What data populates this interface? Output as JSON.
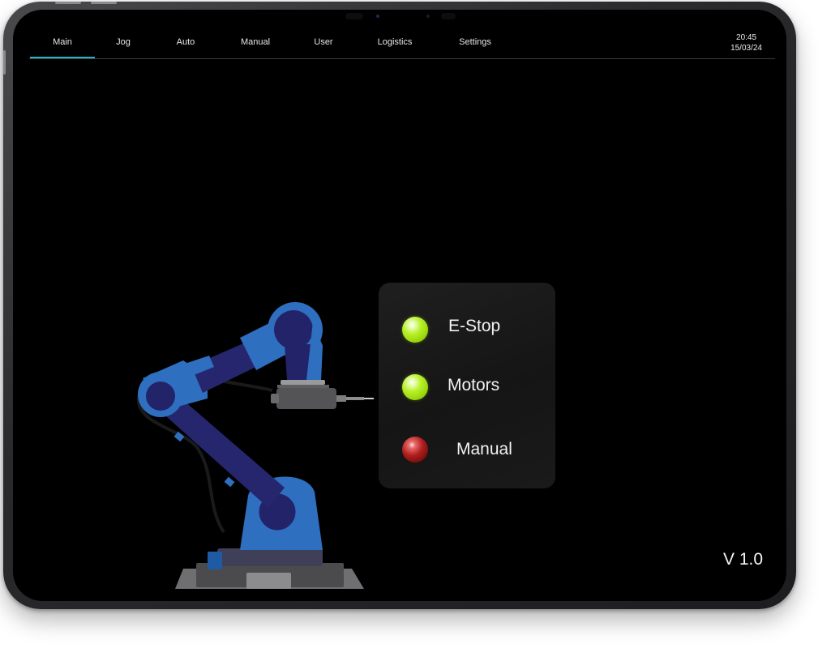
{
  "nav": {
    "tabs": [
      {
        "label": "Main",
        "active": true
      },
      {
        "label": "Jog",
        "active": false
      },
      {
        "label": "Auto",
        "active": false
      },
      {
        "label": "Manual",
        "active": false
      },
      {
        "label": "User",
        "active": false
      },
      {
        "label": "Logistics",
        "active": false
      },
      {
        "label": "Settings",
        "active": false
      }
    ],
    "accent_color": "#2cb3c9"
  },
  "clock": {
    "time": "20:45",
    "date": "15/03/24"
  },
  "status": {
    "items": [
      {
        "label": "E-Stop",
        "state": "green"
      },
      {
        "label": "Motors",
        "state": "green"
      },
      {
        "label": "Manual",
        "state": "red"
      }
    ],
    "colors": {
      "green": "#b8f02a",
      "red": "#b01e1e"
    }
  },
  "version": "V 1.0",
  "illustration": {
    "icon": "robot-arm-icon",
    "colors": {
      "arm": "#2f6fc0",
      "arm_dark": "#23236a",
      "base": "#5a5a5a"
    }
  }
}
